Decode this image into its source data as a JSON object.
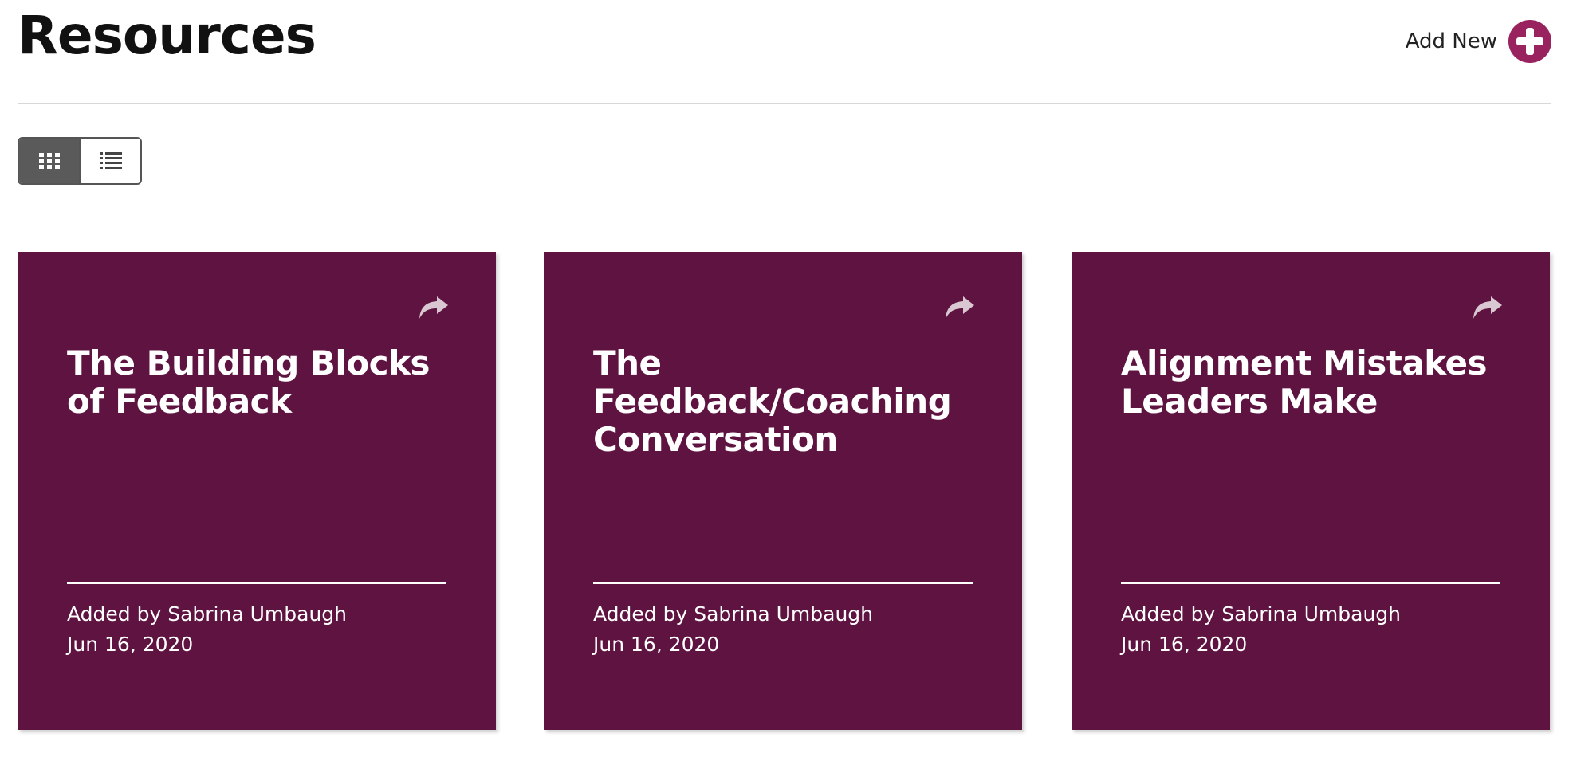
{
  "header": {
    "title": "Resources",
    "add_new_label": "Add New"
  },
  "view_toggle": {
    "active": "grid",
    "options": [
      "grid",
      "list"
    ]
  },
  "colors": {
    "card_background": "#5e1340",
    "accent": "#98235f",
    "toggle_active": "#5a5a5a"
  },
  "cards": [
    {
      "title": "The Building Blocks of Feedback",
      "added_by": "Added by Sabrina Umbaugh",
      "date": "Jun 16, 2020"
    },
    {
      "title": "The Feedback/Coaching Conversation",
      "added_by": "Added by Sabrina Umbaugh",
      "date": "Jun 16, 2020"
    },
    {
      "title": "Alignment Mistakes Leaders Make",
      "added_by": "Added by Sabrina Umbaugh",
      "date": "Jun 16, 2020"
    }
  ]
}
